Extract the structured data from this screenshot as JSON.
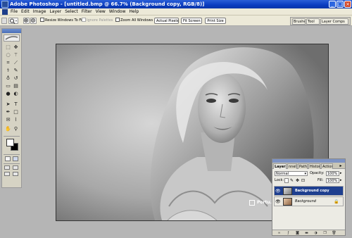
{
  "window": {
    "title": "Adobe Photoshop - [untitled.bmp @ 66.7% (Background copy, RGB/8)]",
    "minimize_glyph": "_",
    "maximize_glyph": "□",
    "close_glyph": "×"
  },
  "menu": [
    "File",
    "Edit",
    "Image",
    "Layer",
    "Select",
    "Filter",
    "View",
    "Window",
    "Help"
  ],
  "options_bar": {
    "resize_windows_label": "Resize Windows To Fit",
    "ignore_palettes_label": "Ignore Palettes",
    "zoom_all_label": "Zoom All Windows",
    "actual_pixels_label": "Actual Pixels",
    "fit_screen_label": "Fit Screen",
    "print_size_label": "Print Size"
  },
  "palette_well_tabs": [
    "Brushes",
    "Tool Pr",
    "Layer Comps"
  ],
  "tools": [
    {
      "icon": "marquee-icon",
      "glyph": "⬚"
    },
    {
      "icon": "move-icon",
      "glyph": "✥"
    },
    {
      "icon": "lasso-icon",
      "glyph": "◌"
    },
    {
      "icon": "magic-wand-icon",
      "glyph": "⚚"
    },
    {
      "icon": "crop-icon",
      "glyph": "⌗"
    },
    {
      "icon": "slice-icon",
      "glyph": "⟋"
    },
    {
      "icon": "healing-brush-icon",
      "glyph": "⚕"
    },
    {
      "icon": "brush-icon",
      "glyph": "✎"
    },
    {
      "icon": "clone-stamp-icon",
      "glyph": "♁"
    },
    {
      "icon": "history-brush-icon",
      "glyph": "↺"
    },
    {
      "icon": "eraser-icon",
      "glyph": "▭"
    },
    {
      "icon": "gradient-icon",
      "glyph": "▤"
    },
    {
      "icon": "blur-icon",
      "glyph": "●"
    },
    {
      "icon": "dodge-icon",
      "glyph": "◐"
    },
    {
      "icon": "path-selection-icon",
      "glyph": "➤"
    },
    {
      "icon": "type-icon",
      "glyph": "T"
    },
    {
      "icon": "pen-icon",
      "glyph": "✒"
    },
    {
      "icon": "shape-icon",
      "glyph": "□"
    },
    {
      "icon": "notes-icon",
      "glyph": "✉"
    },
    {
      "icon": "eyedropper-icon",
      "glyph": "⌇"
    },
    {
      "icon": "hand-icon",
      "glyph": "✋"
    },
    {
      "icon": "zoom-icon",
      "glyph": "⚲"
    }
  ],
  "watermark": "Portu.co",
  "layers_panel": {
    "tabs": [
      "Layers",
      "nnels",
      "Paths",
      "History",
      "Actions"
    ],
    "blend_mode": "Normal",
    "opacity_label": "Opacity:",
    "opacity_value": "100%",
    "lock_label": "Lock:",
    "fill_label": "Fill:",
    "fill_value": "100%",
    "layers": [
      {
        "name": "Background copy",
        "visible": true,
        "selected": true,
        "locked": false
      },
      {
        "name": "Background",
        "visible": true,
        "selected": false,
        "locked": true
      }
    ],
    "bottom_icons": [
      "link-icon",
      "layer-style-icon",
      "mask-icon",
      "folder-icon",
      "adjustment-icon",
      "new-layer-icon",
      "trash-icon"
    ]
  },
  "colors": {
    "title_bar": "#0a3cc0",
    "workspace": "#b5b5b5",
    "selected_layer": "#1e3f8f",
    "foreground": "#ffffff",
    "background": "#000000"
  }
}
